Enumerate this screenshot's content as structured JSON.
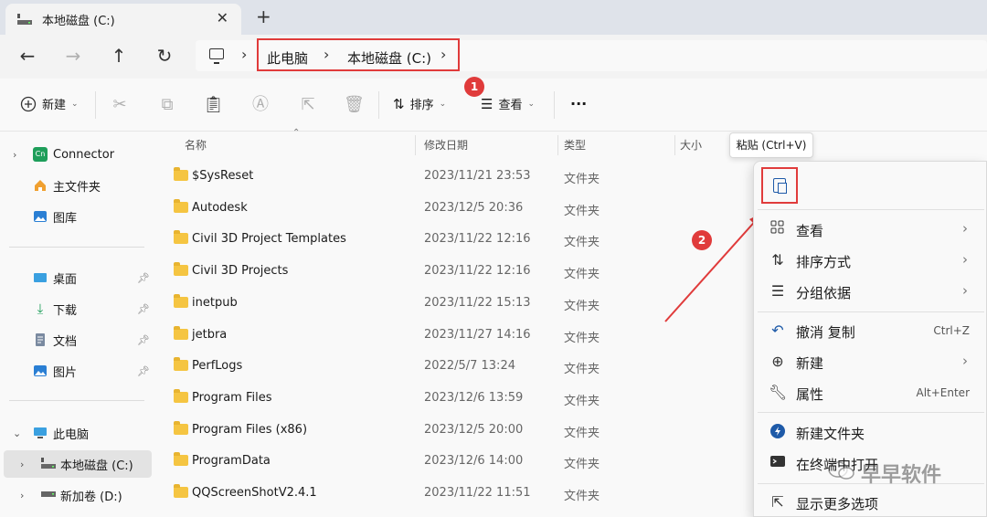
{
  "tab": {
    "title": "本地磁盘 (C:)",
    "close": "✕",
    "new_tab": "+"
  },
  "nav": {
    "back": "←",
    "forward": "→",
    "up": "↑",
    "refresh": "↻"
  },
  "breadcrumb": {
    "items": [
      "此电脑",
      "本地磁盘 (C:)"
    ],
    "sep": "›"
  },
  "toolbar": {
    "new_label": "新建",
    "sort_label": "排序",
    "view_label": "查看",
    "more_label": "···",
    "badge1": "1"
  },
  "sidebar": {
    "connector": "Connector",
    "home": "主文件夹",
    "gallery": "图库",
    "desktop": "桌面",
    "downloads": "下载",
    "documents": "文档",
    "pictures": "图片",
    "this_pc": "此电脑",
    "local_c": "本地磁盘 (C:)",
    "new_d": "新加卷 (D:)"
  },
  "columns": {
    "name": "名称",
    "modified": "修改日期",
    "type": "类型",
    "size": "大小"
  },
  "files": [
    {
      "name": "$SysReset",
      "date": "2023/11/21 23:53",
      "type": "文件夹"
    },
    {
      "name": "Autodesk",
      "date": "2023/12/5 20:36",
      "type": "文件夹"
    },
    {
      "name": "Civil 3D Project Templates",
      "date": "2023/11/22 12:16",
      "type": "文件夹"
    },
    {
      "name": "Civil 3D Projects",
      "date": "2023/11/22 12:16",
      "type": "文件夹"
    },
    {
      "name": "inetpub",
      "date": "2023/11/22 15:13",
      "type": "文件夹"
    },
    {
      "name": "jetbra",
      "date": "2023/11/27 14:16",
      "type": "文件夹"
    },
    {
      "name": "PerfLogs",
      "date": "2022/5/7 13:24",
      "type": "文件夹"
    },
    {
      "name": "Program Files",
      "date": "2023/12/6 13:59",
      "type": "文件夹"
    },
    {
      "name": "Program Files (x86)",
      "date": "2023/12/5 20:00",
      "type": "文件夹"
    },
    {
      "name": "ProgramData",
      "date": "2023/12/6 14:00",
      "type": "文件夹"
    },
    {
      "name": "QQScreenShotV2.4.1",
      "date": "2023/11/22 11:51",
      "type": "文件夹"
    }
  ],
  "tooltip": "粘贴 (Ctrl+V)",
  "context_menu": {
    "badge2": "2",
    "view": "查看",
    "sort": "排序方式",
    "group": "分组依据",
    "undo": "撤消 复制",
    "undo_sc": "Ctrl+Z",
    "new": "新建",
    "props": "属性",
    "props_sc": "Alt+Enter",
    "new_folder": "新建文件夹",
    "terminal": "在终端中打开",
    "more": "显示更多选项"
  },
  "watermark": "早早软件",
  "colors": {
    "accent_red": "#e03b3b",
    "folder": "#f5c542",
    "blue": "#1e5aa8"
  }
}
